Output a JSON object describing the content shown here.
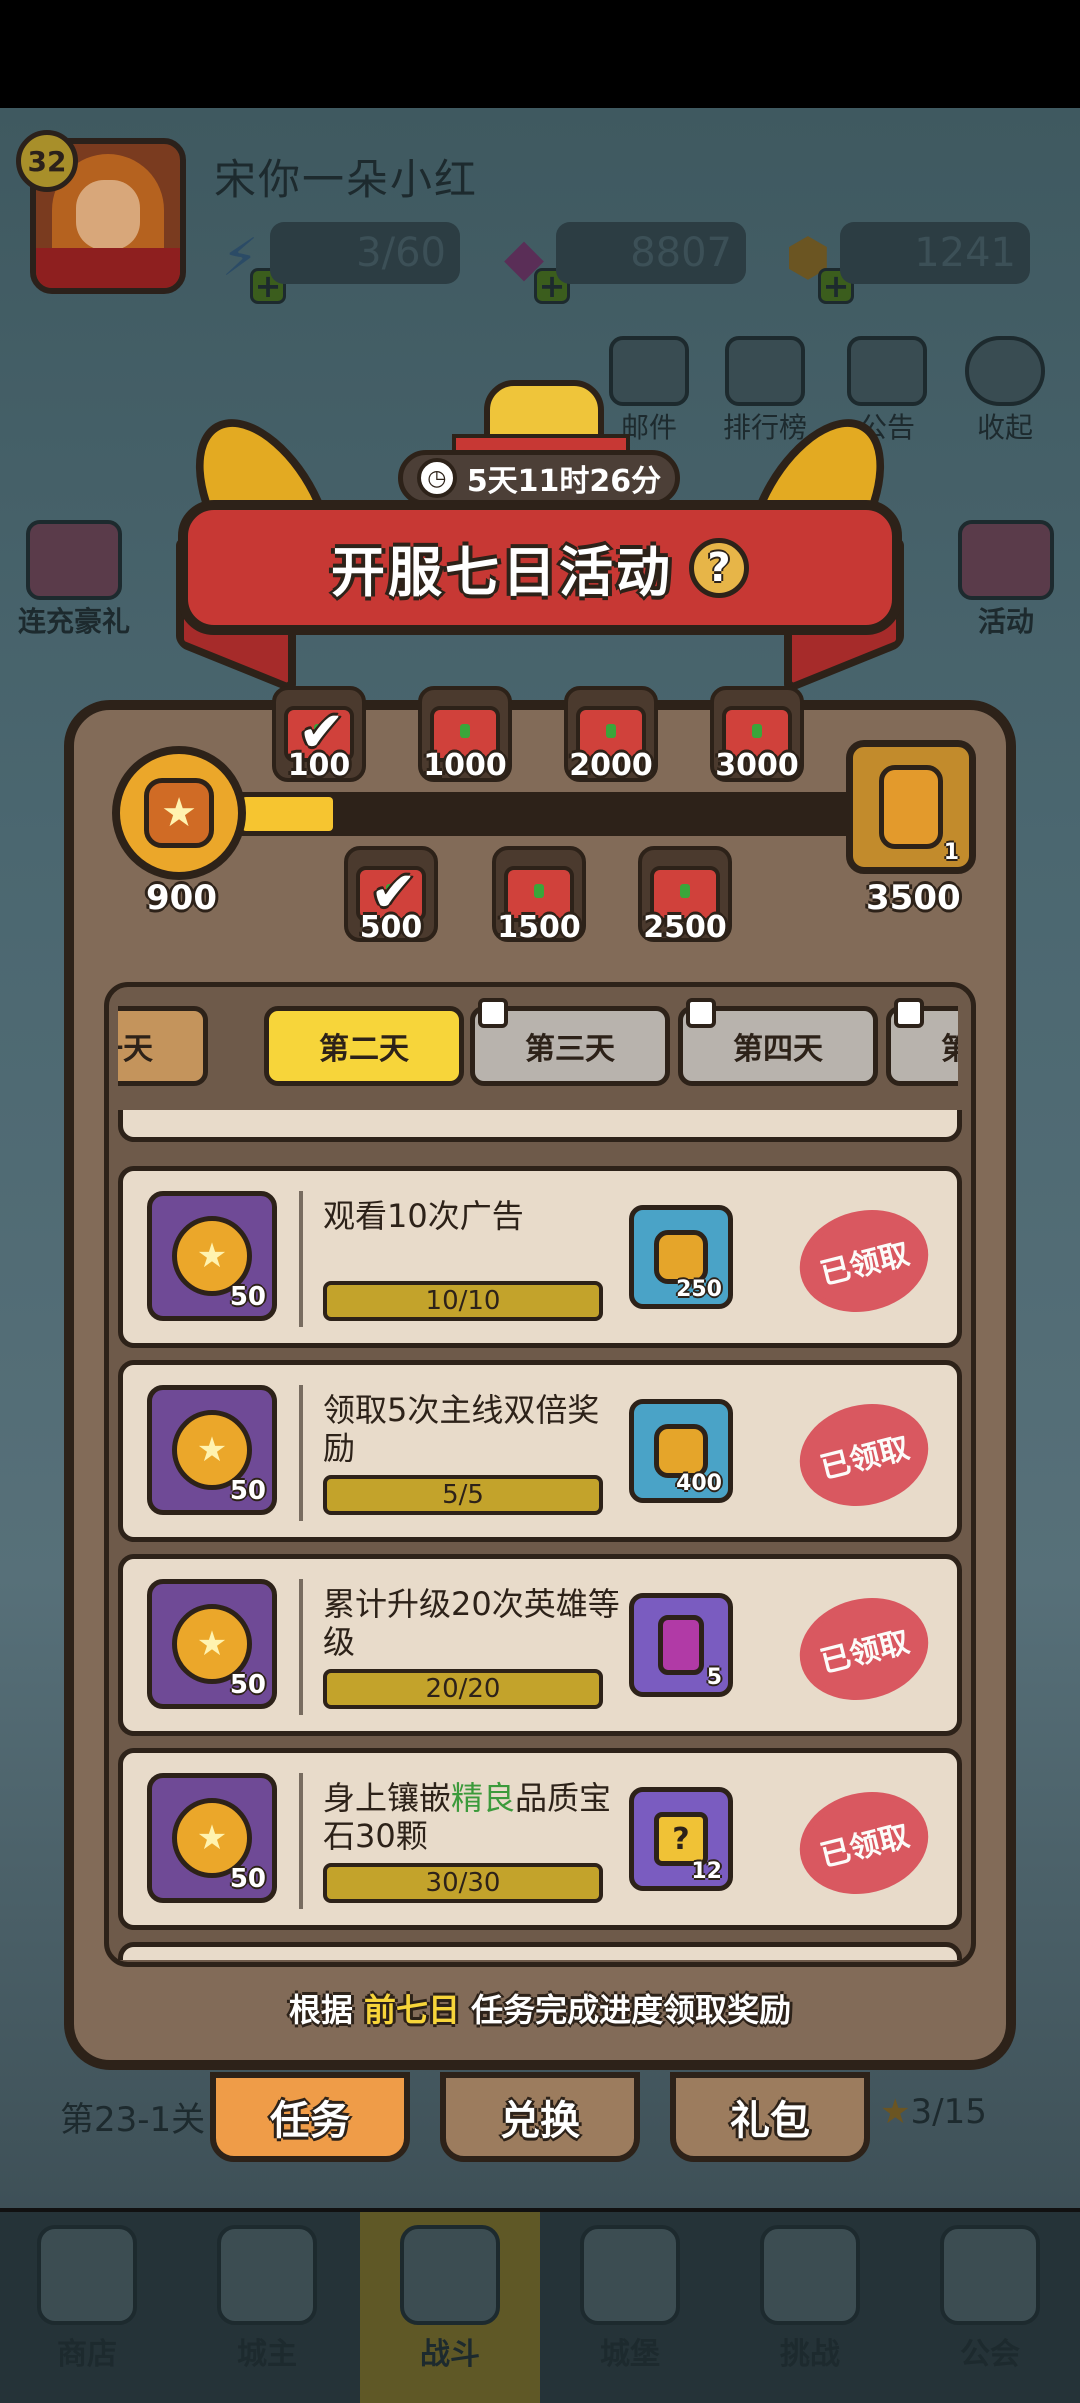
{
  "player": {
    "level": "32",
    "name": "宋你一朵小红"
  },
  "resources": {
    "energy": "3/60",
    "gems": "8807",
    "coins": "1241"
  },
  "top_icons": [
    "邮件",
    "排行榜",
    "公告",
    "收起"
  ],
  "side_left": [
    "连充豪礼"
  ],
  "side_right": [
    "活动"
  ],
  "event": {
    "title": "开服七日活动",
    "help_label": "?",
    "timer": "5天11时26分",
    "current_points": "900",
    "progress_fraction": 0.15,
    "final_reward": {
      "points": "3500",
      "count": "1"
    },
    "milestones_top": [
      {
        "label": "100",
        "claimed": true
      },
      {
        "label": "1000",
        "claimed": false
      },
      {
        "label": "2000",
        "claimed": false
      },
      {
        "label": "3000",
        "claimed": false
      }
    ],
    "milestones_bottom": [
      {
        "label": "500",
        "claimed": true
      },
      {
        "label": "1500",
        "claimed": false
      },
      {
        "label": "2500",
        "claimed": false
      }
    ],
    "day_tabs": [
      {
        "label": "第一天",
        "state": "done"
      },
      {
        "label": "第二天",
        "state": "active"
      },
      {
        "label": "第三天",
        "state": "locked"
      },
      {
        "label": "第四天",
        "state": "locked"
      },
      {
        "label": "第五天",
        "state": "locked"
      }
    ],
    "tasks": [
      {
        "title": "观看10次广告",
        "progress": "10/10",
        "points": "50",
        "reward_type": "coin",
        "reward_count": "250",
        "status": "已领取"
      },
      {
        "title": "领取5次主线双倍奖励",
        "progress": "5/5",
        "points": "50",
        "reward_type": "coin",
        "reward_count": "400",
        "status": "已领取"
      },
      {
        "title": "累计升级20次英雄等级",
        "progress": "20/20",
        "points": "50",
        "reward_type": "gem",
        "reward_count": "5",
        "status": "已领取"
      },
      {
        "title_pre": "身上镶嵌",
        "title_hl": "精良",
        "title_post": "品质宝石30颗",
        "progress": "30/30",
        "points": "50",
        "reward_type": "puzzle",
        "reward_count": "12",
        "status": "已领取"
      }
    ],
    "footer_pre": "根据 ",
    "footer_hl": "前七日",
    "footer_post": " 任务完成进度领取奖励",
    "bottom_tabs": [
      "任务",
      "兑换",
      "礼包"
    ]
  },
  "background": {
    "stage_text": "第23-1关",
    "stars_text": "3/15"
  },
  "bottom_nav": [
    "商店",
    "城主",
    "战斗",
    "城堡",
    "挑战",
    "公会"
  ],
  "colors": {
    "modal_bg": "#826b58",
    "accent_yellow": "#f7d53a",
    "banner_red": "#c73834",
    "stamp_red": "#d84a55"
  }
}
